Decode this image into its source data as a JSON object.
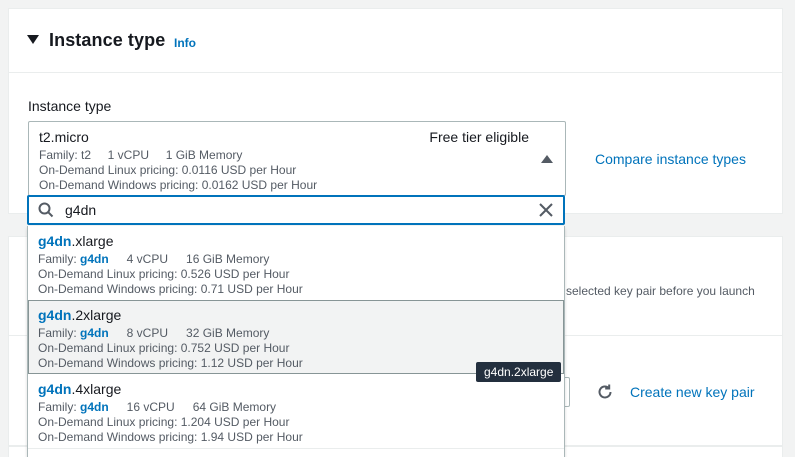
{
  "instance_section": {
    "title": "Instance type",
    "info_link": "Info",
    "field_label": "Instance type",
    "selected": {
      "name": "t2.micro",
      "badge": "Free tier eligible",
      "family_line": "Family: t2     1 vCPU     1 GiB Memory",
      "linux_pricing": "On-Demand Linux pricing: 0.0116 USD per Hour",
      "windows_pricing": "On-Demand Windows pricing: 0.0162 USD per Hour"
    },
    "compare_link": "Compare instance types"
  },
  "search": {
    "value": "g4dn"
  },
  "options": [
    {
      "match": "g4dn",
      "rest": ".xlarge",
      "family_label": "Family: ",
      "family": "g4dn",
      "vcpu": "4 vCPU",
      "memory": "16 GiB Memory",
      "linux_pricing": "On-Demand Linux pricing: 0.526 USD per Hour",
      "windows_pricing": "On-Demand Windows pricing: 0.71 USD per Hour"
    },
    {
      "match": "g4dn",
      "rest": ".2xlarge",
      "family_label": "Family: ",
      "family": "g4dn",
      "vcpu": "8 vCPU",
      "memory": "32 GiB Memory",
      "linux_pricing": "On-Demand Linux pricing: 0.752 USD per Hour",
      "windows_pricing": "On-Demand Windows pricing: 1.12 USD per Hour"
    },
    {
      "match": "g4dn",
      "rest": ".4xlarge",
      "family_label": "Family: ",
      "family": "g4dn",
      "vcpu": "16 vCPU",
      "memory": "64 GiB Memory",
      "linux_pricing": "On-Demand Linux pricing: 1.204 USD per Hour",
      "windows_pricing": "On-Demand Windows pricing: 1.94 USD per Hour"
    }
  ],
  "tooltip": "g4dn.2xlarge",
  "keypair_section": {
    "hint_fragment": "selected key pair before you launch",
    "create_link": "Create new key pair"
  },
  "colors": {
    "link": "#0073bb",
    "focus_border": "#0073bb",
    "tooltip_bg": "#232f3e"
  }
}
